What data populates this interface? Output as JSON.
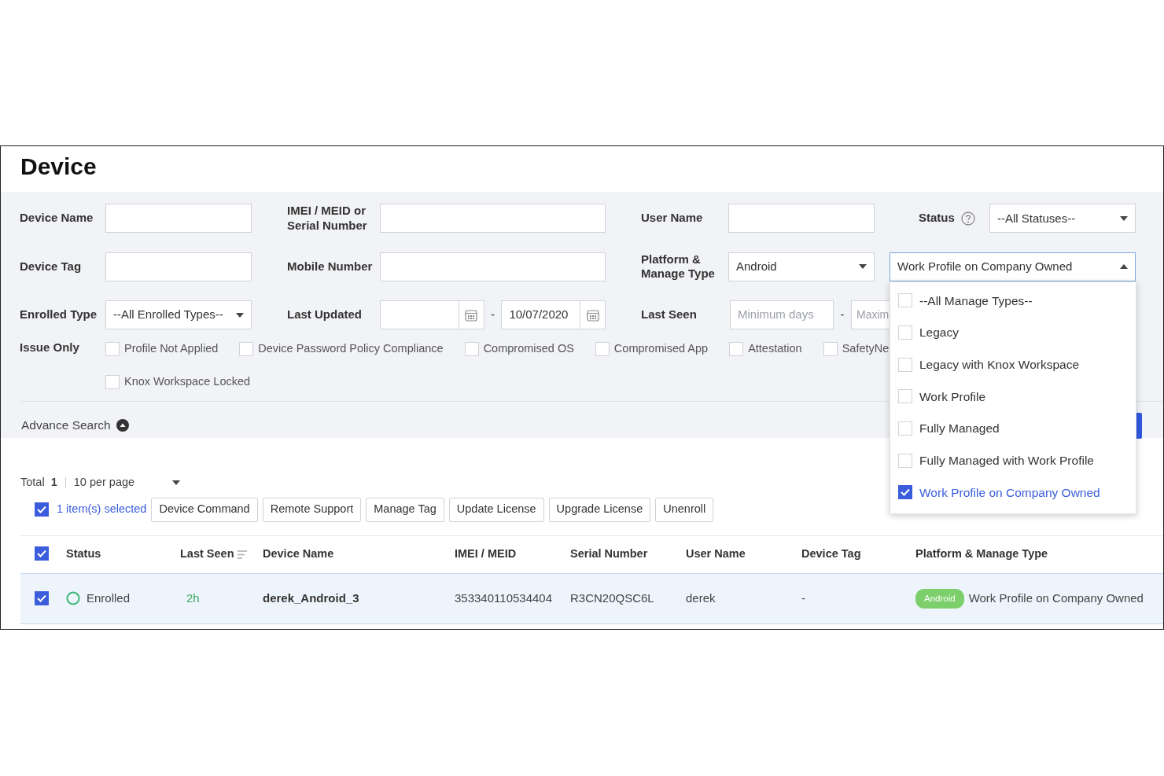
{
  "page": {
    "title": "Device"
  },
  "filters": {
    "rows": [
      [
        {
          "kind": "text",
          "label": "Device Name"
        },
        {
          "kind": "text",
          "label": "IMEI / MEID or\nSerial Number"
        },
        {
          "kind": "text",
          "label": "User Name"
        },
        {
          "kind": "select",
          "label": "Status",
          "help": true,
          "value": "--All Statuses--",
          "expanded": false
        }
      ],
      [
        {
          "kind": "text",
          "label": "Device Tag"
        },
        {
          "kind": "text",
          "label": "Mobile Number"
        },
        {
          "kind": "select",
          "label": "Platform &\nManage Type",
          "value": "Android",
          "expanded": false
        },
        {
          "kind": "select",
          "value": "Work Profile on Company Owned",
          "expanded": true
        }
      ],
      [
        {
          "kind": "select",
          "label": "Enrolled Type",
          "value": "--All Enrolled Types--",
          "expanded": false
        },
        {
          "kind": "date_range",
          "label": "Last Updated",
          "separator": "-",
          "to": "10/07/2020"
        },
        {
          "kind": "number_range",
          "label": "Last Seen",
          "min_placeholder": "Minimum days",
          "separator": "-",
          "max_placeholder": "Maxim"
        }
      ]
    ],
    "issue_only": {
      "label": "Issue Only",
      "options": [
        {
          "label": "Profile Not Applied",
          "checked": false
        },
        {
          "label": "Device Password Policy Compliance",
          "checked": false
        },
        {
          "label": "Compromised OS",
          "checked": false
        },
        {
          "label": "Compromised App",
          "checked": false
        },
        {
          "label": "Attestation",
          "checked": false
        },
        {
          "label": "SafetyNe",
          "checked": false
        },
        {
          "label": "Knox Workspace Locked",
          "checked": false
        }
      ]
    },
    "advance_search": {
      "label": "Advance Search"
    },
    "manage_type_menu": [
      {
        "label": "--All Manage Types--",
        "selected": false
      },
      {
        "label": "Legacy",
        "selected": false
      },
      {
        "label": "Legacy with Knox Workspace",
        "selected": false
      },
      {
        "label": "Work Profile",
        "selected": false
      },
      {
        "label": "Fully Managed",
        "selected": false
      },
      {
        "label": "Fully Managed with Work Profile",
        "selected": false
      },
      {
        "label": "Work Profile on Company Owned",
        "selected": true
      }
    ]
  },
  "summary": {
    "total_label": "Total",
    "total": "1",
    "per_page": "10 per page"
  },
  "selection": {
    "checked": true,
    "text": "1 item(s) selected",
    "actions": [
      "Device Command",
      "Remote Support",
      "Manage Tag",
      "Update License",
      "Upgrade License",
      "Unenroll"
    ]
  },
  "table": {
    "all_selected": true,
    "columns": [
      {
        "label": "Status",
        "sortable": false
      },
      {
        "label": "Last Seen",
        "sortable": true
      },
      {
        "label": "Device Name",
        "sortable": false
      },
      {
        "label": "IMEI / MEID",
        "sortable": false
      },
      {
        "label": "Serial Number",
        "sortable": false
      },
      {
        "label": "User Name",
        "sortable": false
      },
      {
        "label": "Device Tag",
        "sortable": false
      },
      {
        "label": "Platform & Manage Type",
        "sortable": false
      }
    ],
    "rows": [
      {
        "selected": true,
        "status": "Enrolled",
        "last_seen": "2h",
        "device_name": "derek_Android_3",
        "imei": "353340110534404",
        "serial": "R3CN20QSC6L",
        "user_name": "derek",
        "device_tag": "-",
        "platform": "Android",
        "manage_type": "Work Profile on Company Owned"
      }
    ]
  }
}
